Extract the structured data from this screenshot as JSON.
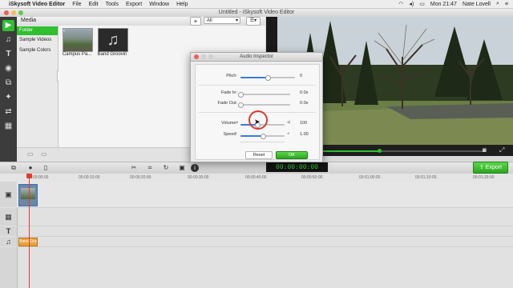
{
  "menubar": {
    "app_name": "iSkysoft Video Editor",
    "items": [
      "File",
      "Edit",
      "Tools",
      "Export",
      "Window",
      "Help"
    ],
    "clock": "Mon 21:47",
    "user": "Nate Lovell"
  },
  "window": {
    "title": "Untitled - iSkysoft Video Editor"
  },
  "media": {
    "header": "Media",
    "add_label": "+",
    "filter_value": "All",
    "list_items": [
      "Folder",
      "Sample Videos",
      "Sample Colors"
    ],
    "thumbs": [
      {
        "caption": "Campus Pa..."
      },
      {
        "caption": "Band Groovin"
      }
    ]
  },
  "toolbar": {
    "timecode": "00:00:00:00",
    "export_label": "Export"
  },
  "timeline": {
    "ruler_ticks": [
      "00:00:00:00",
      "00:00:10:00",
      "00:00:20:00",
      "00:00:30:00",
      "00:00:40:00",
      "00:00:50:00",
      "00:01:00:00",
      "00:01:10:00",
      "00:01:20:00"
    ],
    "audio_clip_label": "Band Groovin"
  },
  "inspector": {
    "title": "Audio Inspector",
    "params": [
      {
        "label": "Pitch:",
        "value": "0",
        "position": 0.5
      },
      {
        "label": "Fade In:",
        "value": "0.0s",
        "position": 0.0
      },
      {
        "label": "Fade Out:",
        "value": "0.0s",
        "position": 0.0
      },
      {
        "label": "Volume:",
        "value": "100",
        "position": 0.38
      },
      {
        "label": "Speed:",
        "value": "1.00",
        "position": 0.5
      }
    ],
    "reset_label": "Reset",
    "ok_label": "OK"
  },
  "colors": {
    "accent_green": "#2fbf2f",
    "slider_blue": "#3b7ad8",
    "playhead_red": "#e23b2e",
    "audio_clip": "#e8a33a"
  },
  "preview": {
    "progress": 0.41
  }
}
